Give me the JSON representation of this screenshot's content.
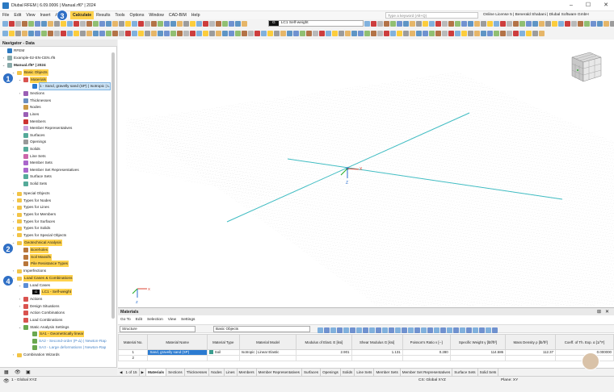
{
  "window": {
    "title": "Dlubal RFEM | 6.09.0006 | Manual.rf6* | 2024"
  },
  "menu": [
    "File",
    "Edit",
    "View",
    "Insert",
    "Assign",
    "Calculate",
    "Results",
    "Tools",
    "Options",
    "Window",
    "CAD-BIM",
    "Help"
  ],
  "search": {
    "placeholder": "Type a keyword (Alt+Q)"
  },
  "license": "Online License 5 | Benerald Shabani | Dlubal Software GmbH",
  "loadcase": {
    "tag": "G",
    "code": "LC1",
    "name": "Self-weight"
  },
  "navigator": {
    "title": "Navigator - Data",
    "root": "RFEM",
    "project1": "Example-02-EN-CEN.rf6",
    "project2": "Manual.rf6* | 2024",
    "basic": "Basic Objects",
    "materials": "Materials",
    "material_item": "1 - Sand, gravelly sand (SP) | Isotropic | L",
    "basic_children": [
      "Sections",
      "Thicknesses",
      "Nodes",
      "Lines",
      "Members",
      "Member Representatives",
      "Surfaces",
      "Openings",
      "Solids",
      "Line Sets",
      "Member Sets",
      "Member Set Representatives",
      "Surface Sets",
      "Solid Sets"
    ],
    "folders": [
      "Special Objects",
      "Types for Nodes",
      "Types for Lines",
      "Types for Members",
      "Types for Surfaces",
      "Types for Solids",
      "Types for Special Objects"
    ],
    "geo": "Geotechnical Analysis",
    "geo_children": [
      "Boreholes",
      "Soil Massifs",
      "Pile Resistance Types"
    ],
    "imperfections": "Imperfections",
    "lcc": "Load Cases & Combinations",
    "load_cases": "Load Cases",
    "lc1_tag": "G",
    "lc1": "LC1 - Self-weight",
    "lcc_children": [
      "Actions",
      "Design Situations",
      "Action Combinations",
      "Load Combinations"
    ],
    "static": "Static Analysis Settings",
    "sa1": "SA1 - Geometrically linear",
    "sa2": "SA2 - Second-order (P-Δ) | Newton-Rap",
    "sa3": "SA3 - Large deformations | Newton-Rap",
    "combo": "Combination Wizards"
  },
  "badges": [
    "1",
    "2",
    "3",
    "4"
  ],
  "viewport": {
    "axis_x": "X",
    "axis_z": "Z"
  },
  "materials_panel": {
    "title": "Materials",
    "menu": [
      "Go To",
      "Edit",
      "Selection",
      "View",
      "Settings"
    ],
    "filter": "Structure",
    "group": "Basic Objects",
    "headers": [
      "Material No.",
      "Material Name",
      "Material Type",
      "Material Model",
      "Modulus of Elast. E [ksi]",
      "Shear Modulus G [ksi]",
      "Poisson's Ratio ν [--]",
      "Specific Weight γ [lbf/ft³]",
      "Mass Density ρ [lb/ft³]",
      "Coeff. of Th. Exp. α [1/°F]"
    ],
    "rows": [
      [
        "1",
        "Sand, gravelly sand (SP)",
        "Soil",
        "Isotropic | Linear Elastic",
        "2.901",
        "1.131",
        "0.280",
        "114.586",
        "112.37",
        "0.000000"
      ],
      [
        "2",
        "",
        "",
        "",
        "",
        "",
        "",
        "",
        "",
        ""
      ]
    ],
    "pager": "1 of 15"
  },
  "tabs": [
    "Materials",
    "Sections",
    "Thicknesses",
    "Nodes",
    "Lines",
    "Members",
    "Member Representatives",
    "Surfaces",
    "Openings",
    "Solids",
    "Line Sets",
    "Member Sets",
    "Member Set Representatives",
    "Surface Sets",
    "Solid Sets"
  ],
  "status": {
    "view": "1 - Global XYZ",
    "cs": "CS: Global XYZ",
    "plane": "Plane: XY"
  },
  "colors": {
    "accent": "#ffd24d",
    "badge": "#2f6fc5",
    "grid_axis": "#3fbcc2"
  }
}
